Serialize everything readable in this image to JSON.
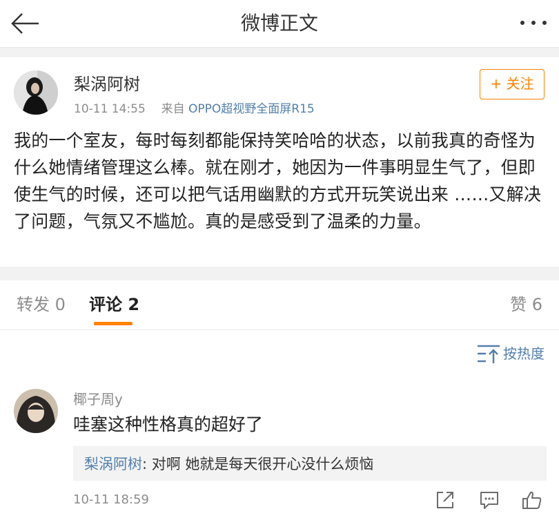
{
  "header": {
    "title": "微博正文",
    "back_icon": "back-arrow-icon",
    "more_icon": "more-dots-icon"
  },
  "post": {
    "author": "梨涡阿树",
    "time": "10-11 14:55",
    "source_prefix": "来自",
    "source": "OPPO超视野全面屏R15",
    "follow_label": "+ 关注",
    "text": "我的一个室友，每时每刻都能保持笑哈哈的状态，以前我真的奇怪为什么她情绪管理这么棒。就在刚才，她因为一件事明显生气了，但即使生气的时候，还可以把气话用幽默的方式开玩笑说出来 ……又解决了问题，气氛又不尴尬。真的是感受到了温柔的力量。"
  },
  "tabs": {
    "repost": "转发 0",
    "comments": "评论 2",
    "like": "赞 6"
  },
  "sort": {
    "label": "按热度",
    "icon": "sort-icon"
  },
  "comment": {
    "author": "椰子周y",
    "text": "哇塞这种性格真的超好了",
    "reply_author": "梨涡阿树",
    "reply_text": ": 对啊 她就是每天很开心没什么烦恼",
    "time": "10-11 18:59",
    "actions": [
      "share-icon",
      "reply-icon",
      "like-icon"
    ]
  },
  "colors": {
    "accent": "#ff8200",
    "link": "#527fab",
    "muted": "#8c8c8c",
    "divider": "#f2f2f2"
  }
}
